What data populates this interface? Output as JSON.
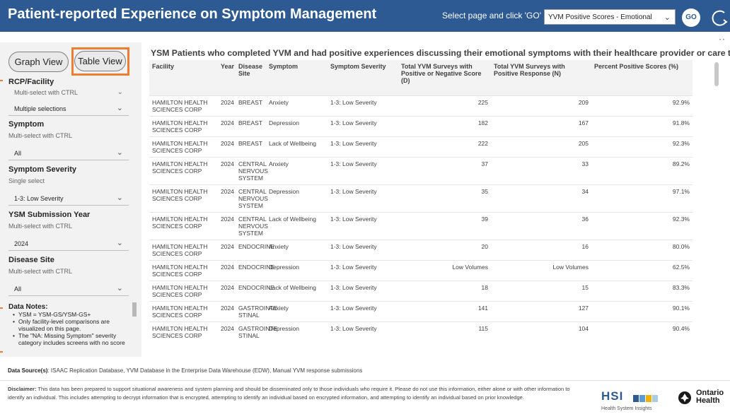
{
  "header": {
    "title": "Patient-reported Experience on Symptom Management",
    "page_prompt": "Select page and click 'GO'",
    "page_select_value": "YVM Positive Scores - Emotional",
    "go_label": "GO"
  },
  "left_panel": {
    "graph_view_label": "Graph View",
    "table_view_label": "Table View",
    "filters": {
      "rcp": {
        "label": "RCP/Facility",
        "hint": "Multi-select with CTRL",
        "value": "Multiple selections"
      },
      "symptom": {
        "label": "Symptom",
        "hint": "Multi-select with CTRL",
        "value": "All"
      },
      "severity": {
        "label": "Symptom Severity",
        "hint": "Single select",
        "value": "1-3: Low Severity"
      },
      "year": {
        "label": "YSM Submission Year",
        "hint": "Multi-select with CTRL",
        "value": "2024"
      },
      "disease_site": {
        "label": "Disease Site",
        "hint": "Multi-select with CTRL",
        "value": "All"
      }
    },
    "data_notes": {
      "title": "Data Notes:",
      "items": [
        "YSM = YSM-GS/YSM-GS+",
        "Only facility-level comparisons are visualized on this page.",
        "The \"NA: Missing Symptom\" severity category includes screens with no score"
      ]
    }
  },
  "main": {
    "heading": "YSM Patients who completed YVM and had positive experiences discussing their emotional symptoms with their healthcare provider or care team.",
    "columns": [
      "Facility",
      "Year",
      "Disease Site",
      "Symptom",
      "Symptom Severity",
      "Total YVM Surveys with Positive or Negative Score (D)",
      "Total YVM Surveys with Positive Response (N)",
      "Percent Positive Scores (%)"
    ],
    "rows": [
      [
        "HAMILTON HEALTH SCIENCES CORP",
        "2024",
        "BREAST",
        "Anxiety",
        "1-3: Low Severity",
        "225",
        "209",
        "92.9%"
      ],
      [
        "HAMILTON HEALTH SCIENCES CORP",
        "2024",
        "BREAST",
        "Depression",
        "1-3: Low Severity",
        "182",
        "167",
        "91.8%"
      ],
      [
        "HAMILTON HEALTH SCIENCES CORP",
        "2024",
        "BREAST",
        "Lack of Wellbeing",
        "1-3: Low Severity",
        "222",
        "205",
        "92.3%"
      ],
      [
        "HAMILTON HEALTH SCIENCES CORP",
        "2024",
        "CENTRAL NERVOUS SYSTEM",
        "Anxiety",
        "1-3: Low Severity",
        "37",
        "33",
        "89.2%"
      ],
      [
        "HAMILTON HEALTH SCIENCES CORP",
        "2024",
        "CENTRAL NERVOUS SYSTEM",
        "Depression",
        "1-3: Low Severity",
        "35",
        "34",
        "97.1%"
      ],
      [
        "HAMILTON HEALTH SCIENCES CORP",
        "2024",
        "CENTRAL NERVOUS SYSTEM",
        "Lack of Wellbeing",
        "1-3: Low Severity",
        "39",
        "36",
        "92.3%"
      ],
      [
        "HAMILTON HEALTH SCIENCES CORP",
        "2024",
        "ENDOCRINE",
        "Anxiety",
        "1-3: Low Severity",
        "20",
        "16",
        "80.0%"
      ],
      [
        "HAMILTON HEALTH SCIENCES CORP",
        "2024",
        "ENDOCRINE",
        "Depression",
        "1-3: Low Severity",
        "Low Volumes",
        "Low Volumes",
        "62.5%"
      ],
      [
        "HAMILTON HEALTH SCIENCES CORP",
        "2024",
        "ENDOCRINE",
        "Lack of Wellbeing",
        "1-3: Low Severity",
        "18",
        "15",
        "83.3%"
      ],
      [
        "HAMILTON HEALTH SCIENCES CORP",
        "2024",
        "GASTROINTE STINAL",
        "Anxiety",
        "1-3: Low Severity",
        "141",
        "127",
        "90.1%"
      ],
      [
        "HAMILTON HEALTH SCIENCES CORP",
        "2024",
        "GASTROINTE STINAL",
        "Depression",
        "1-3: Low Severity",
        "115",
        "104",
        "90.4%"
      ]
    ]
  },
  "footer": {
    "source_label": "Data Source(s)",
    "source_text": ": ISAAC Replication Database, YVM Database in the Enterprise Data Warehouse (EDW), Manual YVM response submissions",
    "disclaimer_label": "Disclaimer:",
    "disclaimer_text": " This data has been prepared to support situational awareness and system planning and should be disseminated only to those individuals who require it. Please do not use this information, either alone or with other information to identify an individual. This includes attempting to decrypt information that is encrypted, attempting to identify an individual based on encrypted information, and attempting to identify an individual based on prior knowledge.",
    "hsi_logo_text": "HSI",
    "hsi_logo_sub": "Health System Insights",
    "ontario_line1": "Ontario",
    "ontario_line2": "Health"
  },
  "colors": {
    "header_blue": "#2e5a93",
    "highlight_orange": "#ed7d31"
  }
}
